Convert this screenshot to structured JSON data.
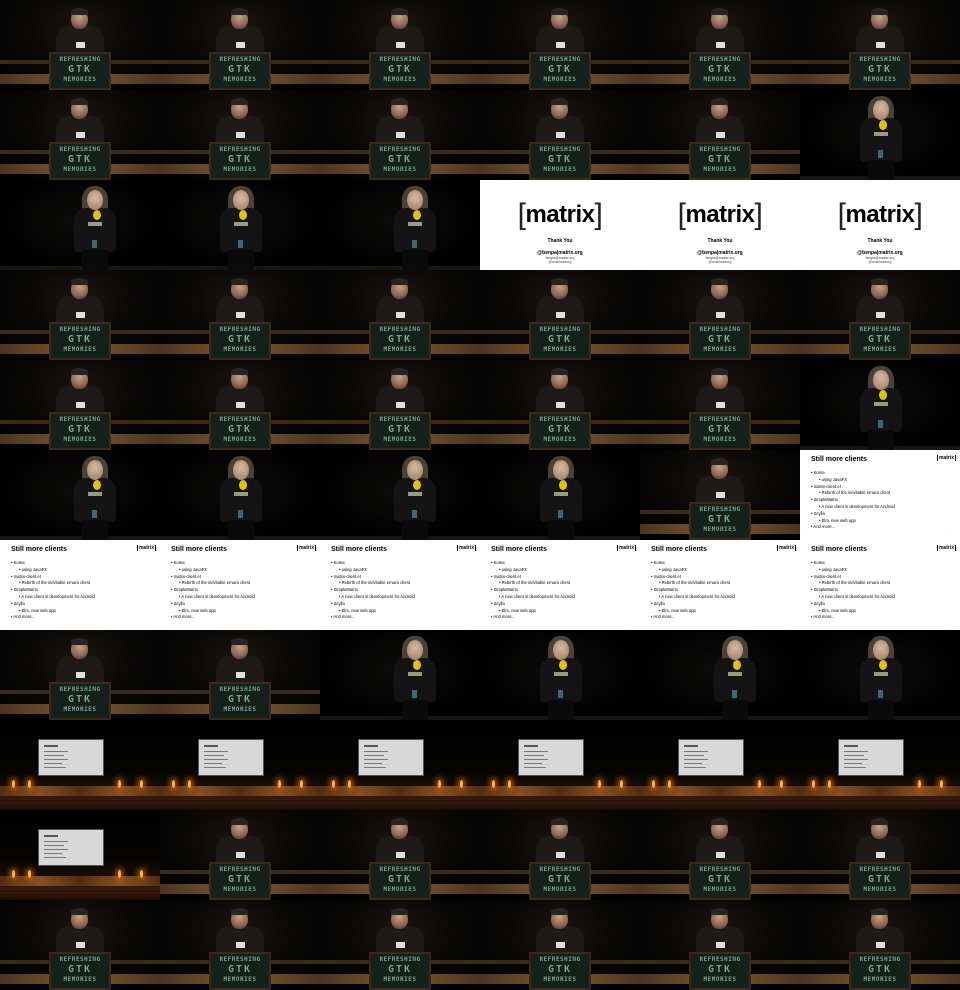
{
  "grid": {
    "columns": 6,
    "rows": 11
  },
  "lectern_sign": {
    "line1": "REFRESHING",
    "line2": "GTK",
    "line3": "MEMORIES"
  },
  "thankyou_slide": {
    "logo": "matrix",
    "heading": "Thank You",
    "handle": "@benpa|matrix.org",
    "line1": "benpa@matrix.org",
    "line2": "@matrixdotorg"
  },
  "clients_slide": {
    "title": "Still more clients",
    "logo": "matrix",
    "items": [
      {
        "text": "• Koma",
        "level": 0
      },
      {
        "text": "• using JavaFX",
        "level": 1
      },
      {
        "text": "• matrix-client.el",
        "level": 0
      },
      {
        "text": "• Rebirth of the inevitable emacs client",
        "level": 1
      },
      {
        "text": "• SimpleMatrix",
        "level": 0
      },
      {
        "text": "• A new client in development for Android",
        "level": 1
      },
      {
        "text": "• Scylla",
        "level": 0
      },
      {
        "text": "• Elm, new web app",
        "level": 1
      },
      {
        "text": "• And more...",
        "level": 0
      }
    ]
  },
  "tiles": [
    "speaker-a",
    "speaker-a",
    "speaker-a",
    "speaker-a",
    "speaker-a",
    "speaker-a",
    "speaker-a",
    "speaker-a",
    "speaker-a",
    "speaker-a",
    "speaker-a",
    "speaker-b",
    "speaker-b",
    "speaker-b",
    "speaker-b",
    "thankyou",
    "thankyou",
    "thankyou",
    "speaker-a",
    "speaker-a",
    "speaker-a",
    "speaker-a",
    "speaker-a",
    "speaker-a",
    "speaker-a",
    "speaker-a",
    "speaker-a",
    "speaker-a",
    "speaker-a",
    "speaker-b",
    "speaker-b",
    "speaker-b",
    "speaker-b",
    "speaker-b",
    "speaker-a",
    "clients",
    "clients",
    "clients",
    "clients",
    "clients",
    "clients",
    "clients",
    "speaker-a",
    "speaker-a",
    "speaker-b",
    "speaker-b",
    "speaker-b",
    "speaker-b",
    "wide",
    "wide",
    "wide",
    "wide",
    "wide",
    "wide",
    "wide",
    "speaker-a",
    "speaker-a",
    "speaker-a",
    "speaker-a",
    "speaker-a",
    "speaker-a",
    "speaker-a",
    "speaker-a",
    "speaker-a",
    "speaker-a",
    "speaker-a"
  ]
}
